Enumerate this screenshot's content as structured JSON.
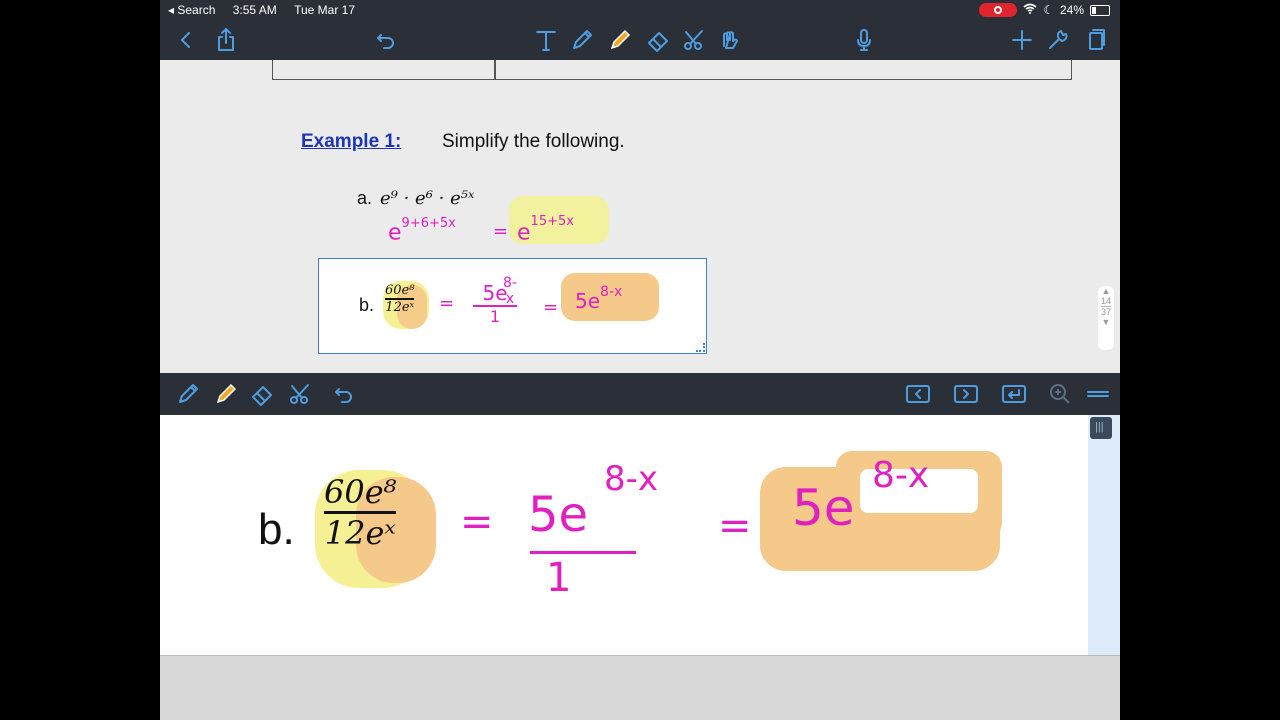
{
  "status": {
    "back_app": "Search",
    "time": "3:55 AM",
    "date": "Tue Mar 17",
    "battery": "24%"
  },
  "toolbar": {
    "icons": [
      "chevron-left-icon",
      "share-icon",
      "undo-icon",
      "text-tool-icon",
      "pen-icon",
      "highlighter-icon",
      "eraser-icon",
      "scissors-icon",
      "lasso-icon",
      "microphone-icon",
      "plus-icon",
      "wrench-icon",
      "pages-icon"
    ]
  },
  "document": {
    "example_title": "Example 1:",
    "instruction": "Simplify the following.",
    "item_a": {
      "label": "a.",
      "problem": "e⁹ · e⁶ · e⁵ˣ",
      "work_base": "e",
      "work_exp": "9+6+5x",
      "equals": "=",
      "answer_base": "e",
      "answer_exp": "15+5x"
    },
    "item_b": {
      "label": "b.",
      "num": "60e⁸",
      "den": "12eˣ",
      "equals": "=",
      "mid_base": "5e",
      "mid_exp": "8-x",
      "mid_den": "1",
      "answer_base": "5e",
      "answer_exp": "8-x"
    },
    "page_indicator": {
      "current": "14",
      "total": "37"
    }
  },
  "zoom": {
    "icons": [
      "pen-icon",
      "highlighter-icon",
      "eraser-icon",
      "scissors-icon",
      "undo-icon",
      "arrow-left-icon",
      "arrow-right-icon",
      "return-icon",
      "zoom-icon",
      "menu-icon"
    ],
    "item_b": {
      "label": "b.",
      "num": "60e⁸",
      "den": "12eˣ",
      "equals": "=",
      "mid_base": "5e",
      "mid_exp": "8-x",
      "mid_den": "1",
      "answer_base": "5e",
      "answer_exp": "8-x"
    }
  },
  "colors": {
    "toolbar_bg": "#2b3038",
    "icon_blue": "#4d9de0",
    "ink_magenta": "#e020c0",
    "highlight_yellow": "#f6f094",
    "highlight_orange": "#f5c98a",
    "link_blue": "#1f35b6"
  }
}
